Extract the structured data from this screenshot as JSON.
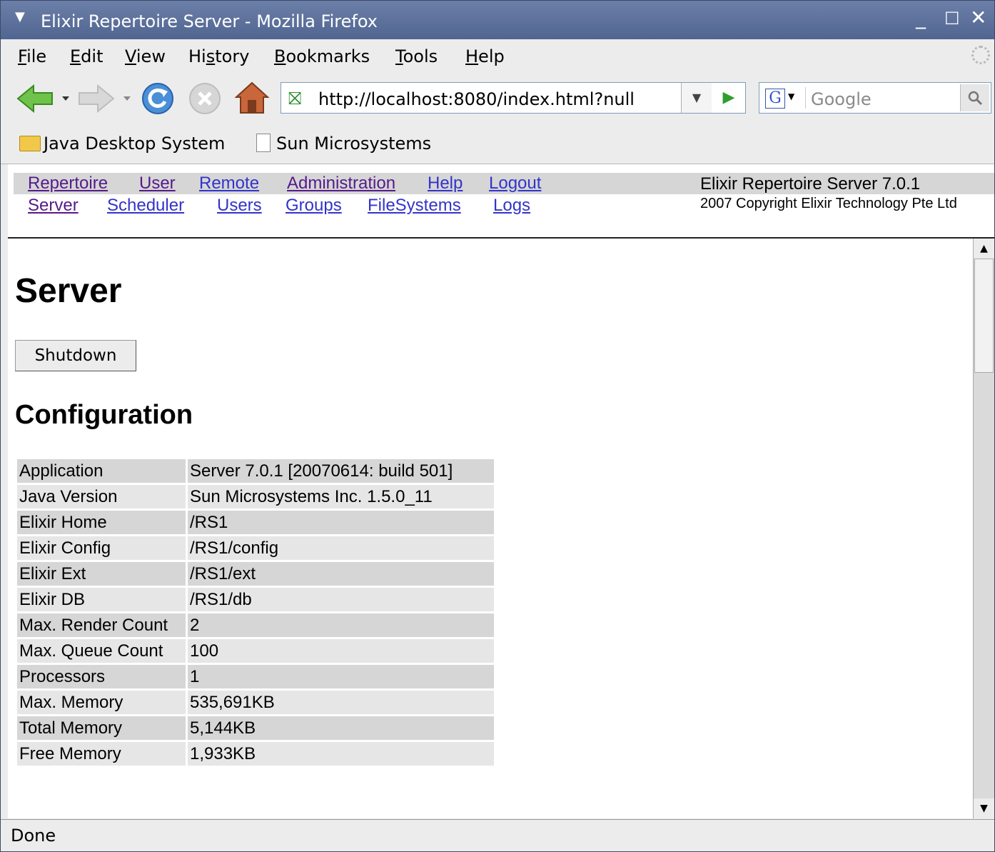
{
  "window": {
    "title": "Elixir Repertoire Server - Mozilla Firefox"
  },
  "menubar": {
    "items": [
      {
        "label": "File",
        "accel": "F",
        "rest": "ile"
      },
      {
        "label": "Edit",
        "accel": "E",
        "rest": "dit"
      },
      {
        "label": "View",
        "accel": "V",
        "rest": "iew"
      },
      {
        "label": "History",
        "pre": "Hi",
        "accel": "s",
        "rest": "tory"
      },
      {
        "label": "Bookmarks",
        "accel": "B",
        "rest": "ookmarks"
      },
      {
        "label": "Tools",
        "accel": "T",
        "rest": "ools"
      },
      {
        "label": "Help",
        "accel": "H",
        "rest": "elp"
      }
    ]
  },
  "toolbar": {
    "url": "http://localhost:8080/index.html?null",
    "search_placeholder": "Google",
    "search_engine": "G"
  },
  "bookmarks": [
    {
      "label": "Java Desktop System",
      "icon": "folder-icon"
    },
    {
      "label": "Sun Microsystems",
      "icon": "page-icon"
    }
  ],
  "site": {
    "nav_row1": [
      "Repertoire",
      "User",
      "Remote",
      "Administration",
      "Help",
      "Logout"
    ],
    "nav_row2": [
      "Server",
      "Scheduler",
      "Users",
      "Groups",
      "FileSystems",
      "Logs"
    ],
    "app_name": "Elixir Repertoire Server 7.0.1",
    "copyright": "2007 Copyright Elixir Technology Pte Ltd"
  },
  "page": {
    "title": "Server",
    "shutdown_label": "Shutdown",
    "config_heading": "Configuration",
    "config_rows": [
      {
        "key": "Application",
        "value": "Server 7.0.1 [20070614: build 501]"
      },
      {
        "key": "Java Version",
        "value": "Sun Microsystems Inc. 1.5.0_11"
      },
      {
        "key": "Elixir Home",
        "value": "/RS1"
      },
      {
        "key": "Elixir Config",
        "value": "/RS1/config"
      },
      {
        "key": "Elixir Ext",
        "value": "/RS1/ext"
      },
      {
        "key": "Elixir DB",
        "value": "/RS1/db"
      },
      {
        "key": "Max. Render Count",
        "value": "2"
      },
      {
        "key": "Max. Queue Count",
        "value": "100"
      },
      {
        "key": "Processors",
        "value": "1"
      },
      {
        "key": "Max. Memory",
        "value": "535,691KB"
      },
      {
        "key": "Total Memory",
        "value": "5,144KB"
      },
      {
        "key": "Free Memory",
        "value": "1,933KB"
      }
    ]
  },
  "status": {
    "text": "Done"
  },
  "colors": {
    "title_bar": "#5a6e99",
    "link": "#3333cc",
    "visited_link": "#551a8b",
    "row_dark": "#d6d6d6",
    "row_light": "#e6e6e6"
  }
}
